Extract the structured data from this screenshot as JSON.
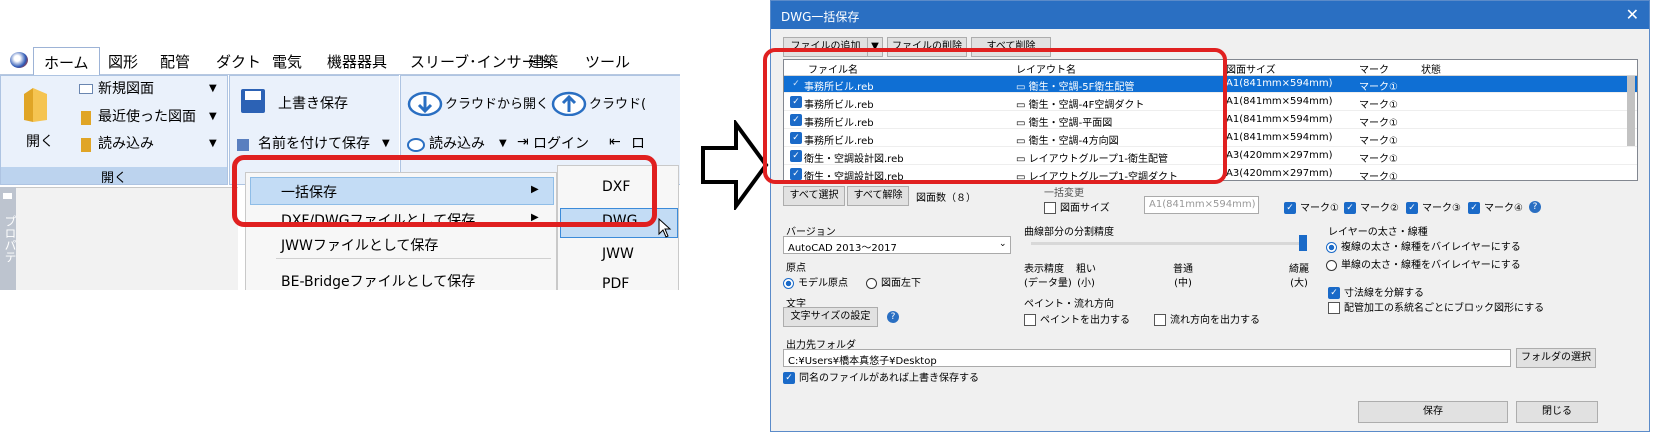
{
  "ribbon": {
    "tabs": [
      "ホーム",
      "図形",
      "配管",
      "ダクト",
      "電気",
      "機器器具",
      "スリーブ･インサート",
      "建築",
      "ツール"
    ],
    "open_label": "開く",
    "new_drawing": "新規図面",
    "recent": "最近使った図面",
    "load": "読み込み",
    "open_group": "開く",
    "overwrite_save": "上書き保存",
    "save_as": "名前を付けて保存",
    "cloud_open": "クラウドから開く",
    "cloud_save_partial": "クラウド(",
    "cloud_load": "読み込み",
    "login": "ログイン",
    "logout_partial": "ロ",
    "sidebar_text": "プロパテ"
  },
  "save_menu": {
    "items": [
      "一括保存",
      "DXF/DWGファイルとして保存",
      "JWWファイルとして保存",
      "BE-Bridgeファイルとして保存"
    ]
  },
  "submenu": {
    "items": [
      "DXF",
      "DWG",
      "JWW",
      "PDF"
    ]
  },
  "dialog": {
    "title": "DWG一括保存",
    "buttons": {
      "add_file": "ファイルの追加",
      "delete_file": "ファイルの削除",
      "delete_all": "すべて削除",
      "select_all": "すべて選択",
      "deselect_all": "すべて解除",
      "count": "図面数（８）",
      "folder_select": "フォルダの選択",
      "save": "保存",
      "close": "閉じる"
    },
    "columns": [
      "ファイル名",
      "レイアウト名",
      "図面サイズ",
      "マーク",
      "状態"
    ],
    "rows": [
      {
        "file": "事務所ビル.reb",
        "layout": "衛生・空調-5F衛生配管",
        "size": "A1(841mm×594mm)",
        "mark": "マーク①"
      },
      {
        "file": "事務所ビル.reb",
        "layout": "衛生・空調-4F空調ダクト",
        "size": "A1(841mm×594mm)",
        "mark": "マーク①"
      },
      {
        "file": "事務所ビル.reb",
        "layout": "衛生・空調-平面図",
        "size": "A1(841mm×594mm)",
        "mark": "マーク①"
      },
      {
        "file": "事務所ビル.reb",
        "layout": "衛生・空調-4方向図",
        "size": "A1(841mm×594mm)",
        "mark": "マーク①"
      },
      {
        "file": "衛生・空調設計図.reb",
        "layout": "レイアウトグループ1-衛生配管",
        "size": "A3(420mm×297mm)",
        "mark": "マーク①"
      },
      {
        "file": "衛生・空調設計図.reb",
        "layout": "レイアウトグループ1-空調ダクト",
        "size": "A3(420mm×297mm)",
        "mark": "マーク①"
      }
    ],
    "batch_label": "一括変更",
    "size_label": "図面サイズ",
    "size_value": "A1(841mm×594mm)",
    "marks": [
      "マーク①",
      "マーク②",
      "マーク③",
      "マーク④"
    ],
    "version_label": "バージョン",
    "version_value": "AutoCAD 2013～2017",
    "curve_label": "曲線部分の分割精度",
    "display_precision": "表示精度\n(データ量)",
    "coarse": "粗い\n(小)",
    "normal": "普通\n(中)",
    "fine": "綺麗\n(大)",
    "layer_label": "レイヤーの太さ・線種",
    "layer_opt1": "複線の太さ・線種をバイレイヤーにする",
    "layer_opt2": "単線の太さ・線種をバイレイヤーにする",
    "origin_label": "原点",
    "origin_model": "モデル原点",
    "origin_lowerleft": "図面左下",
    "split_dims": "寸法線を分解する",
    "block_by_system": "配管加工の系統名ごとにブロック図形にする",
    "text_label": "文字",
    "text_size_btn": "文字サイズの設定",
    "paint_label": "ペイント・流れ方向",
    "paint_opt": "ペイントを出力する",
    "flow_opt": "流れ方向を出力する",
    "output_label": "出力先フォルダ",
    "output_path": "C:¥Users¥橋本真悠子¥Desktop",
    "overwrite_label": "同名のファイルがあれば上書き保存する"
  },
  "colors": {
    "highlight": "#e02020",
    "title_bar": "#2a6fc2",
    "selected_row": "#0f6fd4"
  }
}
